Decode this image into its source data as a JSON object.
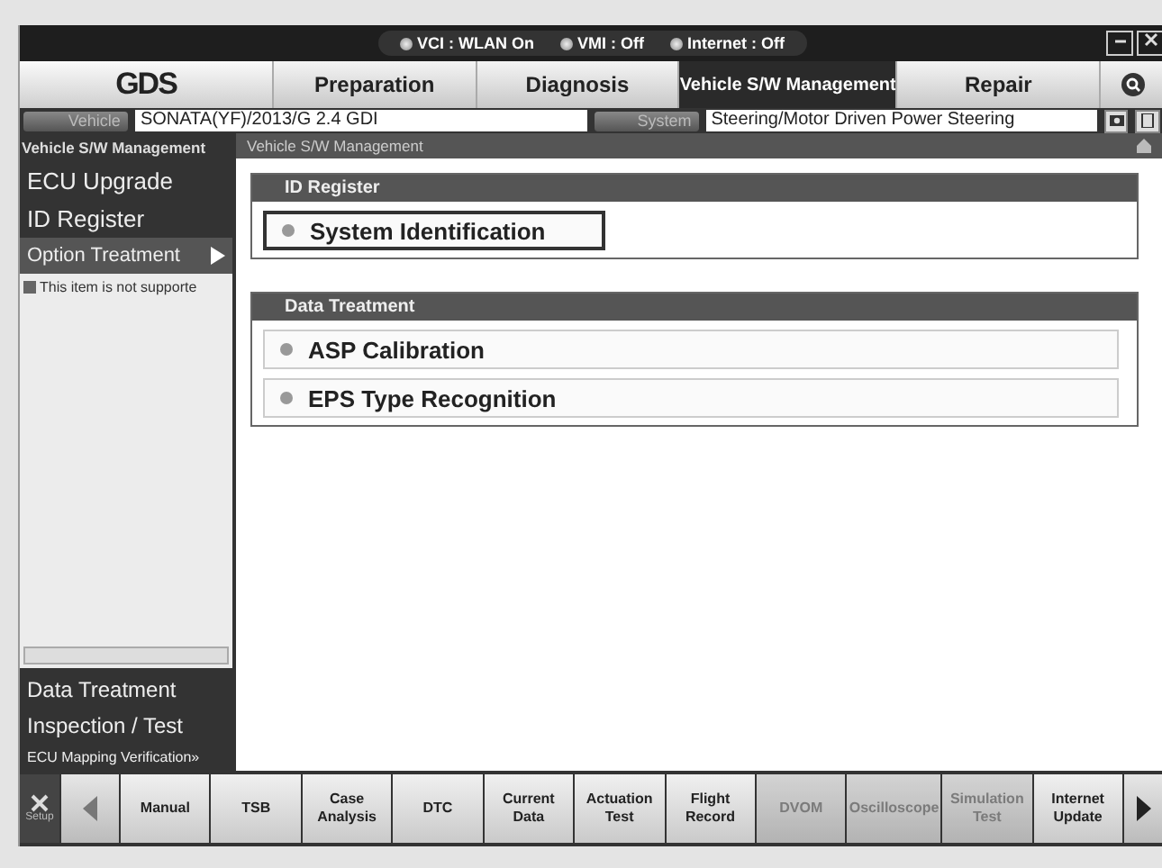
{
  "status_bar": [
    {
      "label": "VCI : WLAN On"
    },
    {
      "label": "VMI : Off"
    },
    {
      "label": "Internet : Off"
    }
  ],
  "logo": "GDS",
  "tabs": [
    {
      "label": "Preparation",
      "selected": false
    },
    {
      "label": "Diagnosis",
      "selected": false
    },
    {
      "label": "Vehicle S/W Management",
      "selected": true
    },
    {
      "label": "Repair",
      "selected": false
    }
  ],
  "vehicle": {
    "label": "Vehicle",
    "value": "SONATA(YF)/2013/G 2.4 GDI"
  },
  "system": {
    "label": "System",
    "value": "Steering/Motor Driven Power Steering"
  },
  "sidebar": {
    "title": "Vehicle S/W Management",
    "items": [
      {
        "label": "ECU Upgrade",
        "selected": false
      },
      {
        "label": "ID Register",
        "selected": false
      },
      {
        "label": "Option Treatment",
        "selected": true
      }
    ],
    "message": "This item is not supporte",
    "bottom_items": [
      {
        "label": "Data Treatment",
        "small": false
      },
      {
        "label": "Inspection / Test",
        "small": false
      },
      {
        "label": "ECU Mapping Verification»",
        "small": true
      }
    ]
  },
  "content": {
    "title": "Vehicle S/W Management",
    "groups": [
      {
        "title": "ID Register",
        "items": [
          {
            "label": "System Identification",
            "selected": true
          }
        ]
      },
      {
        "title": "Data Treatment",
        "items": [
          {
            "label": "ASP Calibration",
            "selected": false
          },
          {
            "label": "EPS Type Recognition",
            "selected": false
          }
        ]
      }
    ]
  },
  "toolbar": {
    "setup": "Setup",
    "buttons": [
      {
        "label": "Manual",
        "disabled": false
      },
      {
        "label": "TSB",
        "disabled": false
      },
      {
        "label": "Case Analysis",
        "disabled": false
      },
      {
        "label": "DTC",
        "disabled": false
      },
      {
        "label": "Current Data",
        "disabled": false
      },
      {
        "label": "Actuation Test",
        "disabled": false
      },
      {
        "label": "Flight Record",
        "disabled": false
      },
      {
        "label": "DVOM",
        "disabled": true
      },
      {
        "label": "Oscilloscope",
        "disabled": true
      },
      {
        "label": "Simulation Test",
        "disabled": true
      },
      {
        "label": "Internet Update",
        "disabled": false
      }
    ]
  }
}
